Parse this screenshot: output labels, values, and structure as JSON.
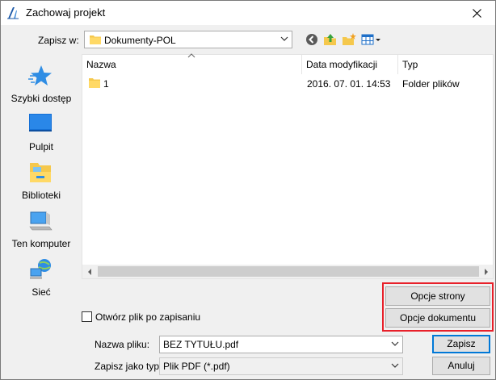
{
  "window": {
    "title": "Zachowaj projekt"
  },
  "toolbar": {
    "save_in_label": "Zapisz w:",
    "location": "Dokumenty-POL"
  },
  "places": [
    {
      "label": "Szybki dostęp",
      "icon": "star-icon"
    },
    {
      "label": "Pulpit",
      "icon": "desktop-icon"
    },
    {
      "label": "Biblioteki",
      "icon": "libraries-icon"
    },
    {
      "label": "Ten komputer",
      "icon": "computer-icon"
    },
    {
      "label": "Sieć",
      "icon": "network-icon"
    }
  ],
  "filelist": {
    "columns": [
      "Nazwa",
      "Data modyfikacji",
      "Typ"
    ],
    "rows": [
      {
        "name": "1",
        "modified": "2016. 07. 01. 14:53",
        "type": "Folder plików"
      }
    ]
  },
  "options": {
    "page_options": "Opcje strony",
    "document_options": "Opcje dokumentu"
  },
  "open_after": {
    "label": "Otwórz plik po zapisaniu",
    "checked": false
  },
  "filename": {
    "label": "Nazwa pliku:",
    "value": "BEZ TYTUŁU.pdf"
  },
  "filetype": {
    "label": "Zapisz jako typ:",
    "value": "Plik PDF (*.pdf)"
  },
  "buttons": {
    "save": "Zapisz",
    "cancel": "Anuluj"
  },
  "colors": {
    "highlight_box": "#e8202a",
    "primary_border": "#0078d7"
  }
}
